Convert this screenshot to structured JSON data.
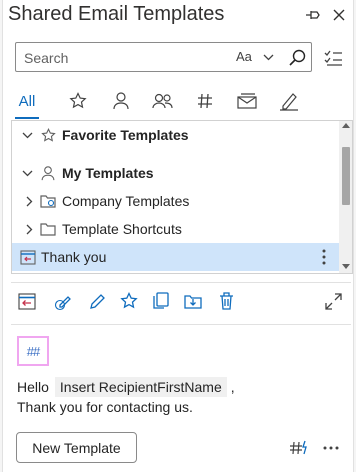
{
  "window": {
    "title": "Shared Email Templates"
  },
  "search": {
    "placeholder": "Search",
    "match_case_label": "Aa"
  },
  "tabs": [
    {
      "label": "All",
      "selected": true
    },
    {
      "icon": "star-icon"
    },
    {
      "icon": "person-icon"
    },
    {
      "icon": "people-icon"
    },
    {
      "icon": "hashtag-icon"
    },
    {
      "icon": "mail-stack-icon"
    },
    {
      "icon": "signature-pen-icon"
    }
  ],
  "tree": {
    "items": [
      {
        "label": "Favorite Templates",
        "bold": true,
        "expanded": true,
        "icon": "star-icon"
      },
      {
        "label": "My Templates",
        "bold": true,
        "expanded": true,
        "icon": "person-icon"
      },
      {
        "label": "Company Templates",
        "expanded": false,
        "icon": "shared-folder-icon"
      },
      {
        "label": "Template Shortcuts",
        "expanded": false,
        "icon": "folder-icon"
      },
      {
        "label": "Thank you",
        "selected": true,
        "icon": "insert-template-icon"
      }
    ]
  },
  "preview": {
    "macro": "##",
    "greeting": "Hello",
    "token": "Insert RecipientFirstName",
    "token_suffix": ",",
    "body": "Thank you for contacting us."
  },
  "footer": {
    "new_template_label": "New Template"
  },
  "colors": {
    "accent": "#0f6cbd",
    "selection": "#cfe4fa",
    "macro_border": "#f0a6f0"
  }
}
